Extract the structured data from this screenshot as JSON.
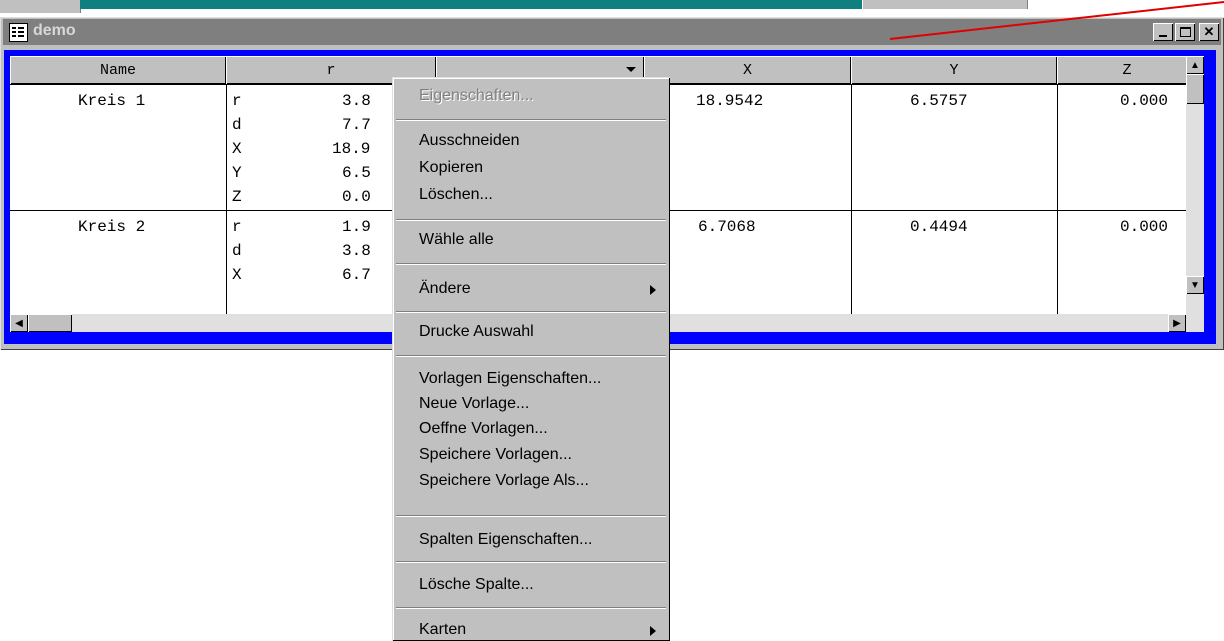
{
  "window": {
    "title": "demo"
  },
  "table": {
    "columns": [
      "Name",
      "r",
      "",
      "X",
      "Y",
      "Z"
    ],
    "rows": [
      {
        "name": "Kreis 1",
        "props": [
          {
            "key": "r",
            "val": "3.8"
          },
          {
            "key": "d",
            "val": "7.7"
          },
          {
            "key": "X",
            "val": "18.9"
          },
          {
            "key": "Y",
            "val": "6.5"
          },
          {
            "key": "Z",
            "val": "0.0"
          }
        ],
        "x": "18.9542",
        "y": "6.5757",
        "z": "0.000"
      },
      {
        "name": "Kreis 2",
        "props": [
          {
            "key": "r",
            "val": "1.9"
          },
          {
            "key": "d",
            "val": "3.8"
          },
          {
            "key": "X",
            "val": "6.7"
          }
        ],
        "x": "6.7068",
        "y": "0.4494",
        "z": "0.000"
      }
    ]
  },
  "context_menu": {
    "items": [
      {
        "label": "Eigenschaften...",
        "disabled": true
      },
      {
        "label": "Ausschneiden"
      },
      {
        "label": "Kopieren"
      },
      {
        "label": "Löschen..."
      },
      {
        "label": "Wähle alle"
      },
      {
        "label": "Ändere",
        "submenu": true
      },
      {
        "label": "Drucke Auswahl"
      },
      {
        "label": "Vorlagen Eigenschaften..."
      },
      {
        "label": "Neue Vorlage..."
      },
      {
        "label": "Oeffne Vorlagen..."
      },
      {
        "label": "Speichere Vorlagen..."
      },
      {
        "label": "Speichere Vorlage Als..."
      },
      {
        "label": "Spalten Eigenschaften..."
      },
      {
        "label": "Lösche Spalte..."
      },
      {
        "label": "Karten",
        "submenu": true
      }
    ]
  },
  "colors": {
    "client_border": "#0000ff",
    "annotation_line": "#e00000"
  }
}
